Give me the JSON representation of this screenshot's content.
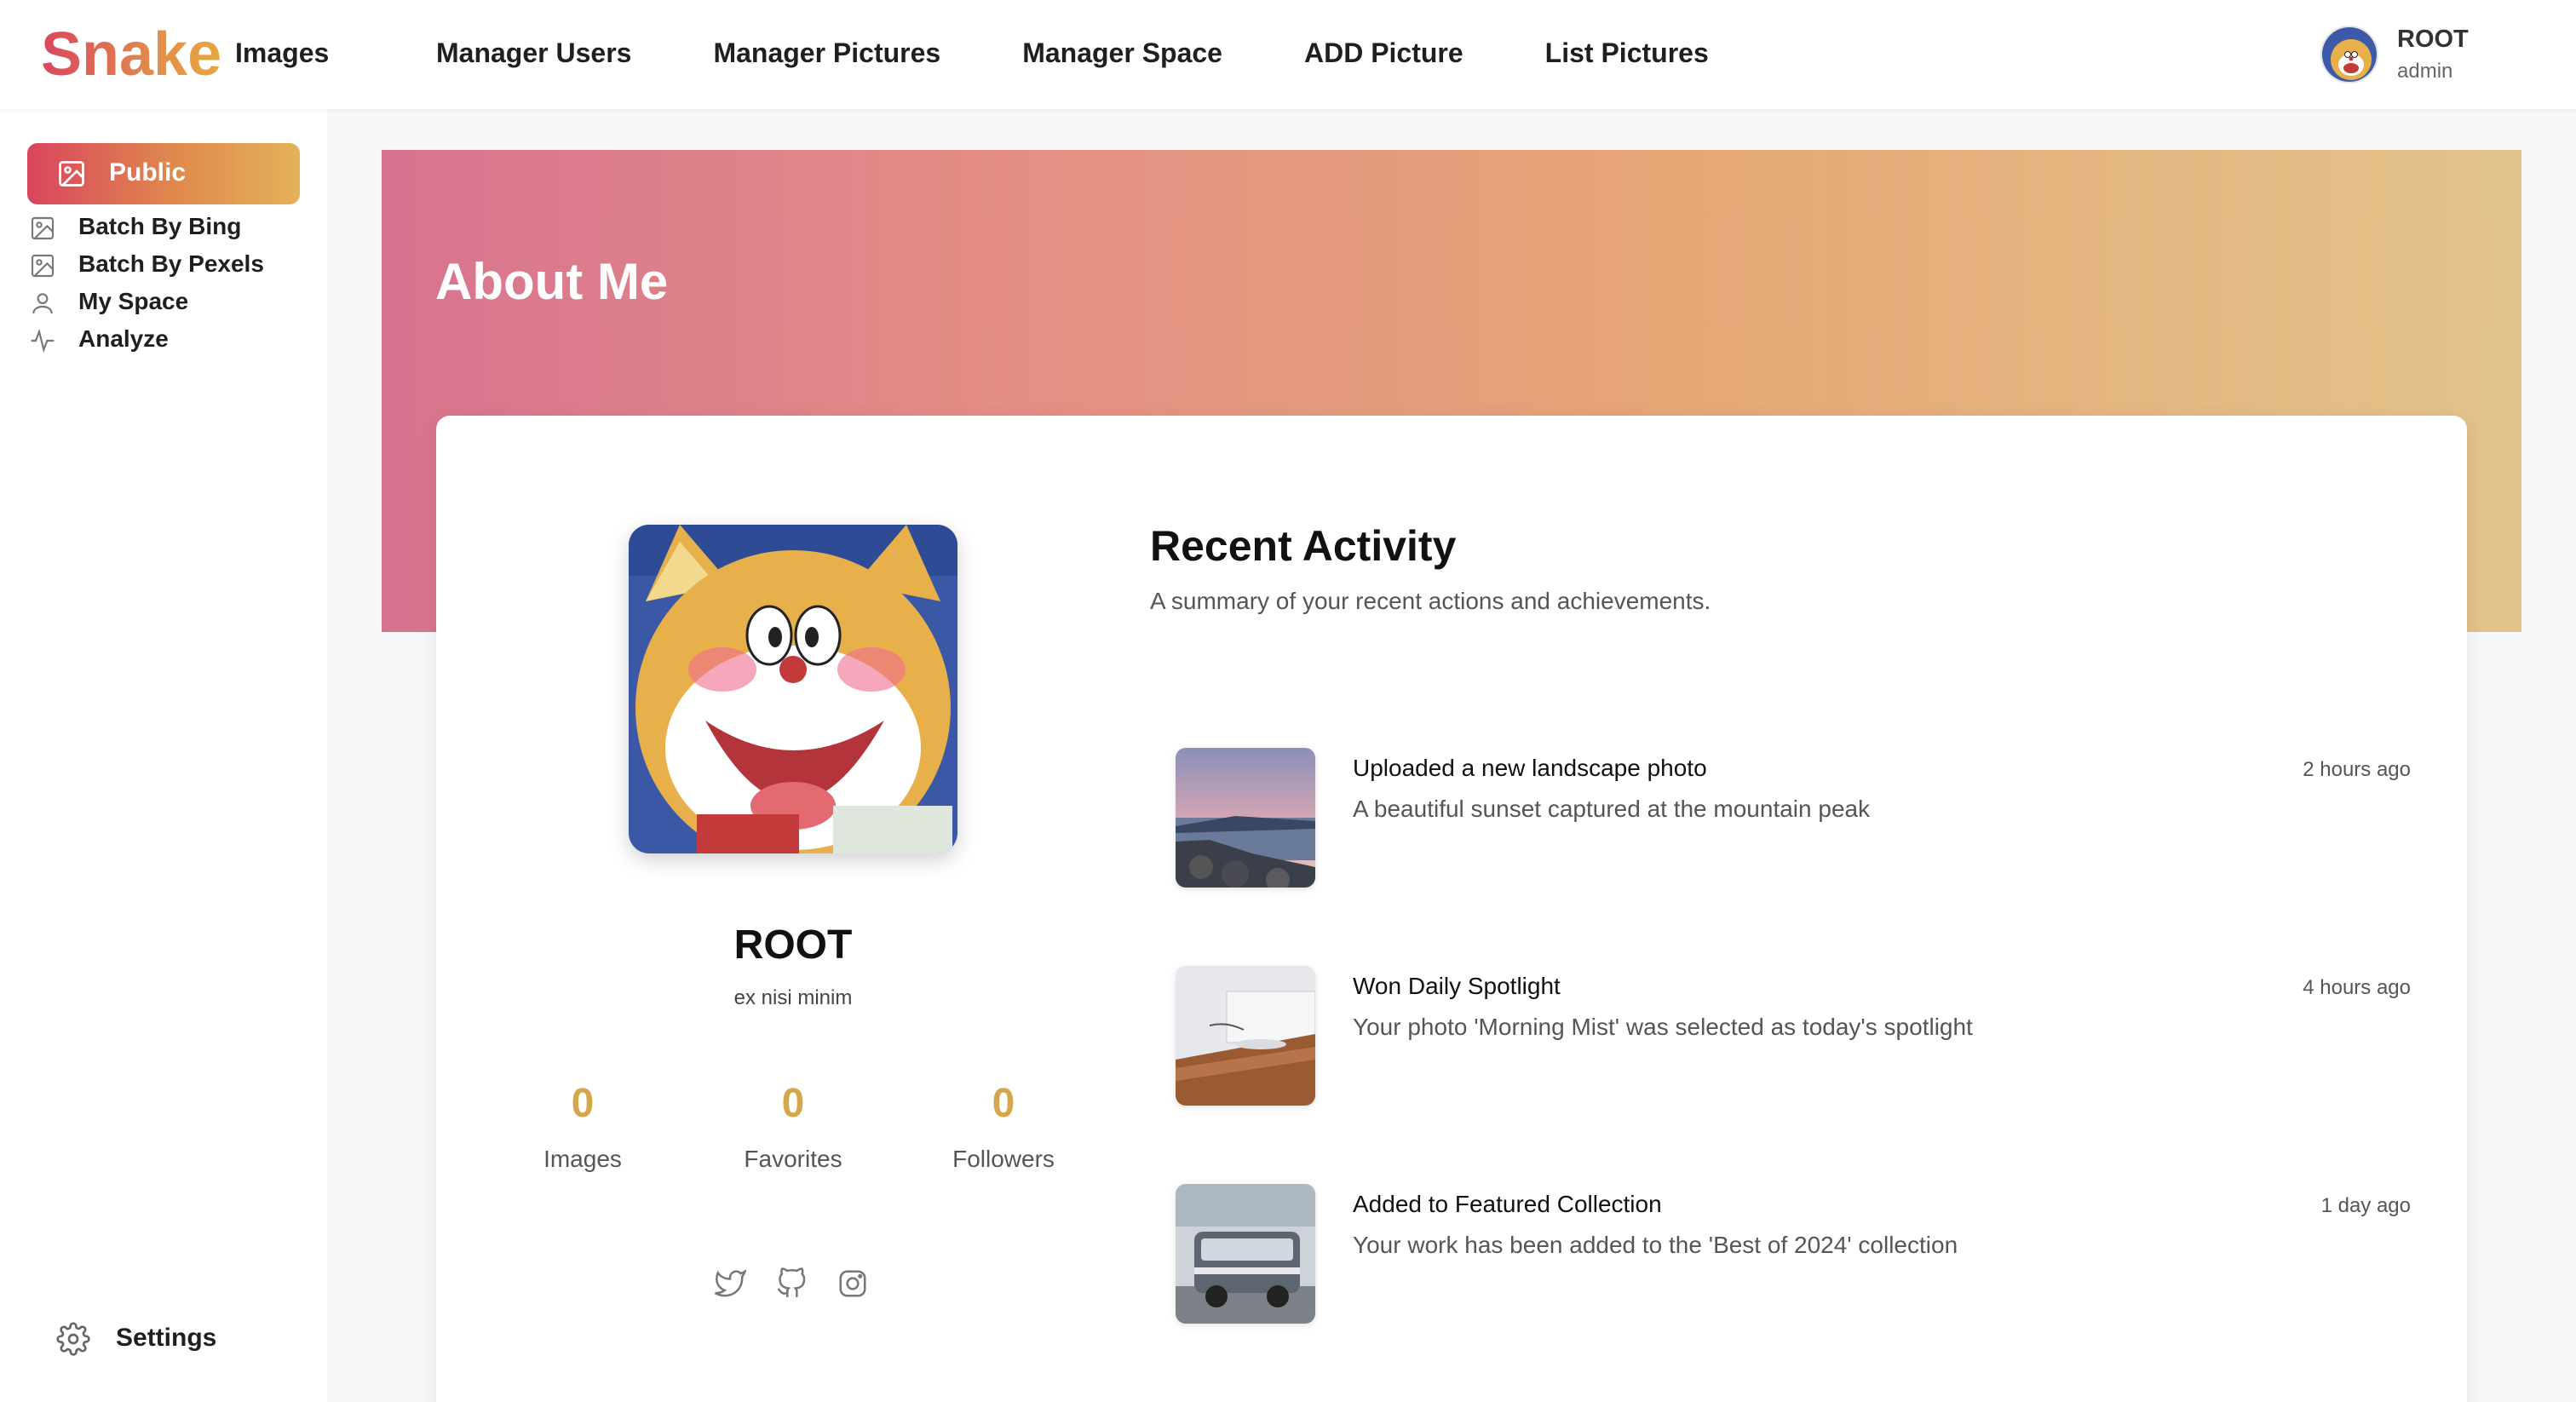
{
  "brand": {
    "logo": "Snake",
    "sub": "Images"
  },
  "nav": [
    {
      "label": "Manager Users"
    },
    {
      "label": "Manager Pictures"
    },
    {
      "label": "Manager Space"
    },
    {
      "label": "ADD Picture"
    },
    {
      "label": "List Pictures"
    }
  ],
  "user": {
    "name": "ROOT",
    "role": "admin"
  },
  "sidebar": {
    "items": [
      {
        "label": "Public",
        "icon": "image-icon",
        "active": true
      },
      {
        "label": "Batch By Bing",
        "icon": "image-icon"
      },
      {
        "label": "Batch By Pexels",
        "icon": "image-icon"
      },
      {
        "label": "My Space",
        "icon": "user-icon"
      },
      {
        "label": "Analyze",
        "icon": "activity-icon"
      }
    ],
    "settings": "Settings"
  },
  "banner": {
    "title": "About Me"
  },
  "profile": {
    "name": "ROOT",
    "bio": "ex nisi minim",
    "stats": [
      {
        "value": "0",
        "label": "Images"
      },
      {
        "value": "0",
        "label": "Favorites"
      },
      {
        "value": "0",
        "label": "Followers"
      }
    ],
    "social": [
      "twitter-icon",
      "github-icon",
      "instagram-icon"
    ]
  },
  "recent": {
    "title": "Recent Activity",
    "subtitle": "A summary of your recent actions and achievements.",
    "items": [
      {
        "title": "Uploaded a new landscape photo",
        "desc": "A beautiful sunset captured at the mountain peak",
        "time": "2 hours ago"
      },
      {
        "title": "Won Daily Spotlight",
        "desc": "Your photo 'Morning Mist' was selected as today's spotlight",
        "time": "4 hours ago"
      },
      {
        "title": "Added to Featured Collection",
        "desc": "Your work has been added to the 'Best of 2024' collection",
        "time": "1 day ago"
      }
    ]
  },
  "colors": {
    "accent_start": "#d9455f",
    "accent_end": "#e4b25a",
    "stat": "#d6a64c"
  }
}
